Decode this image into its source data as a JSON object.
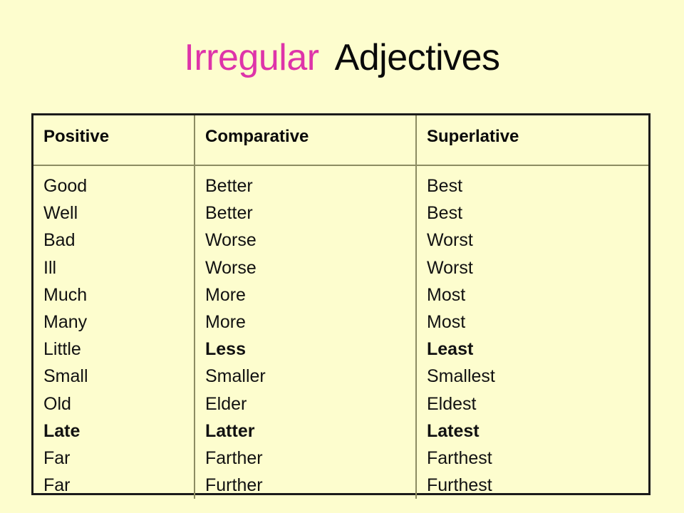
{
  "slide": {
    "background_color": "#fdfdce",
    "title": {
      "part1": "Irregular",
      "part1_color": "#de34a9",
      "part2": "Adjectives",
      "part2_color": "#0a0a0a"
    }
  },
  "table": {
    "border_color": "#1a1a1a",
    "grid_color": "#8c8c62",
    "headers": [
      "Positive",
      "Comparative",
      "Superlative"
    ],
    "columns": {
      "positive": [
        {
          "text": "Good",
          "bold": false
        },
        {
          "text": "Well",
          "bold": false
        },
        {
          "text": "Bad",
          "bold": false
        },
        {
          "text": "Ill",
          "bold": false
        },
        {
          "text": "Much",
          "bold": false
        },
        {
          "text": "Many",
          "bold": false
        },
        {
          "text": "Little",
          "bold": false
        },
        {
          "text": "Small",
          "bold": false
        },
        {
          "text": "Old",
          "bold": false
        },
        {
          "text": "Late",
          "bold": true
        },
        {
          "text": "Far",
          "bold": false
        },
        {
          "text": "Far",
          "bold": false
        }
      ],
      "comparative": [
        {
          "text": "Better",
          "bold": false
        },
        {
          "text": "Better",
          "bold": false
        },
        {
          "text": "Worse",
          "bold": false
        },
        {
          "text": "Worse",
          "bold": false
        },
        {
          "text": "More",
          "bold": false
        },
        {
          "text": "More",
          "bold": false
        },
        {
          "text": "Less",
          "bold": true
        },
        {
          "text": "Smaller",
          "bold": false
        },
        {
          "text": "Elder",
          "bold": false
        },
        {
          "text": "Latter",
          "bold": true
        },
        {
          "text": "Farther",
          "bold": false
        },
        {
          "text": "Further",
          "bold": false
        }
      ],
      "superlative": [
        {
          "text": "Best",
          "bold": false
        },
        {
          "text": "Best",
          "bold": false
        },
        {
          "text": "Worst",
          "bold": false
        },
        {
          "text": "Worst",
          "bold": false
        },
        {
          "text": "Most",
          "bold": false
        },
        {
          "text": "Most",
          "bold": false
        },
        {
          "text": "Least",
          "bold": true
        },
        {
          "text": "Smallest",
          "bold": false
        },
        {
          "text": "Eldest",
          "bold": false
        },
        {
          "text": "Latest",
          "bold": true
        },
        {
          "text": "Farthest",
          "bold": false
        },
        {
          "text": "Furthest",
          "bold": false
        }
      ]
    }
  }
}
